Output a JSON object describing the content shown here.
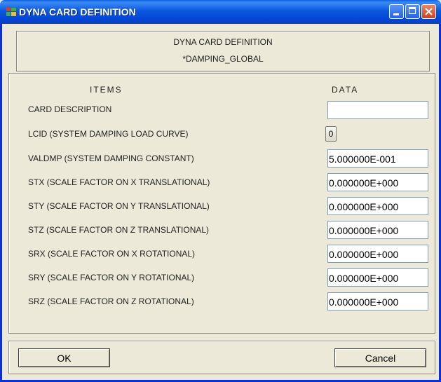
{
  "window": {
    "title": "DYNA CARD DEFINITION",
    "title_bar_color": "#0a57e0",
    "close_button_color": "#d5532c"
  },
  "header": {
    "line1": "DYNA CARD DEFINITION",
    "line2": "*DAMPING_GLOBAL"
  },
  "table": {
    "items_header": "ITEMS",
    "data_header": "DATA",
    "card_description": {
      "label": "CARD DESCRIPTION",
      "value": ""
    },
    "lcid": {
      "label": "LCID (SYSTEM DAMPING LOAD CURVE)",
      "value": "0"
    },
    "valdmp": {
      "label": "VALDMP (SYSTEM DAMPING CONSTANT)",
      "value": "5.000000E-001"
    },
    "stx": {
      "label": "STX (SCALE FACTOR ON X TRANSLATIONAL)",
      "value": "0.000000E+000"
    },
    "sty": {
      "label": "STY (SCALE FACTOR ON Y TRANSLATIONAL)",
      "value": "0.000000E+000"
    },
    "stz": {
      "label": "STZ (SCALE FACTOR ON Z TRANSLATIONAL)",
      "value": "0.000000E+000"
    },
    "srx": {
      "label": "SRX (SCALE FACTOR ON X ROTATIONAL)",
      "value": "0.000000E+000"
    },
    "sry": {
      "label": "SRY (SCALE FACTOR ON Y ROTATIONAL)",
      "value": "0.000000E+000"
    },
    "srz": {
      "label": "SRZ (SCALE FACTOR ON Z ROTATIONAL)",
      "value": "0.000000E+000"
    }
  },
  "buttons": {
    "ok": "OK",
    "cancel": "Cancel"
  }
}
